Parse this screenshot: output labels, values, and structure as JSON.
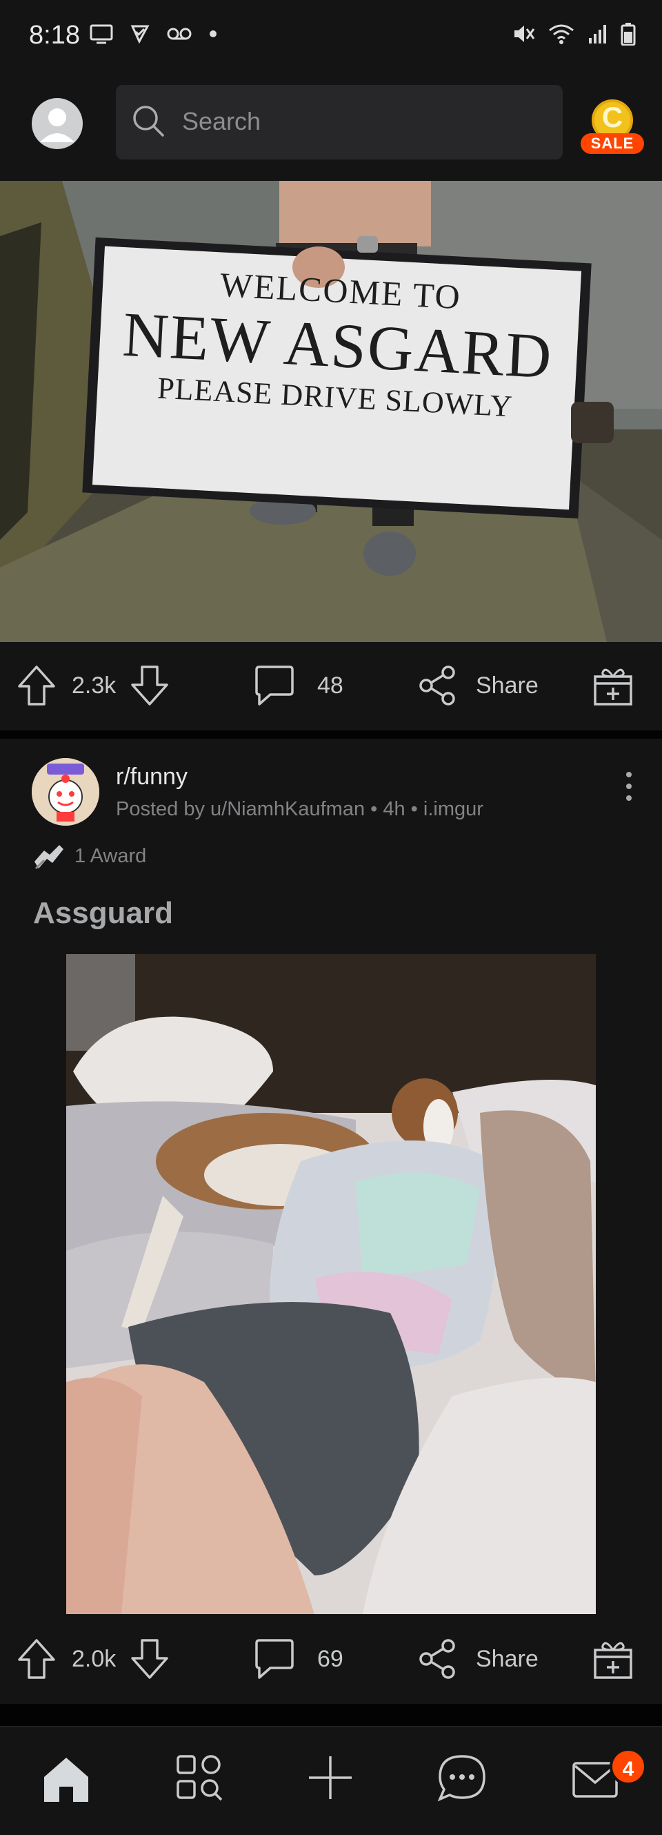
{
  "status_bar": {
    "time": "8:18"
  },
  "header": {
    "search_placeholder": "Search",
    "coin_letter": "C",
    "sale_label": "SALE"
  },
  "post1": {
    "image": {
      "sign_line1": "WELCOME TO",
      "sign_line2": "NEW ASGARD",
      "sign_line3": "PLEASE DRIVE SLOWLY"
    },
    "actions": {
      "votes": "2.3k",
      "comments": "48",
      "share_label": "Share"
    }
  },
  "post2": {
    "subreddit": "r/funny",
    "meta": "Posted by u/NiamhKaufman • 4h • i.imgur",
    "award_text": "1 Award",
    "title": "Assguard",
    "actions": {
      "votes": "2.0k",
      "comments": "69",
      "share_label": "Share"
    }
  },
  "bottom_nav": {
    "items": [
      "home-icon",
      "discover-icon",
      "create-icon",
      "chat-icon",
      "inbox-icon"
    ],
    "inbox_badge": "4"
  },
  "colors": {
    "accent": "#ff4500",
    "background": "#141415",
    "text_muted": "#818384"
  }
}
